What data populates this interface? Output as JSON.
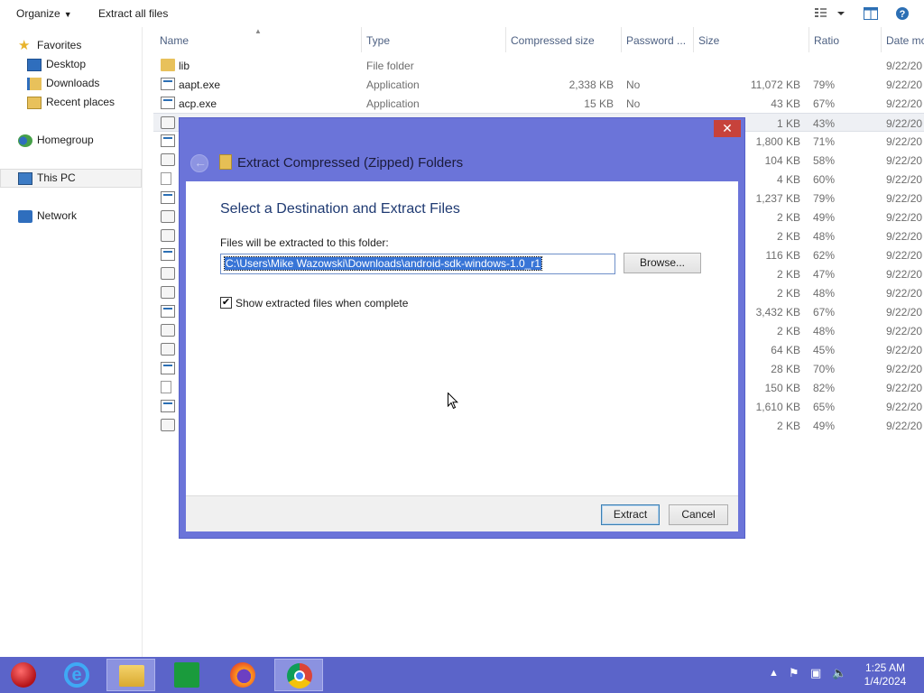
{
  "toolbar": {
    "organize_label": "Organize",
    "extract_all_label": "Extract all files"
  },
  "nav": {
    "favorites": "Favorites",
    "desktop": "Desktop",
    "downloads": "Downloads",
    "recent_places": "Recent places",
    "homegroup": "Homegroup",
    "this_pc": "This PC",
    "network": "Network"
  },
  "columns": {
    "name": "Name",
    "type": "Type",
    "compressed_size": "Compressed size",
    "password": "Password ...",
    "size": "Size",
    "ratio": "Ratio",
    "date": "Date mo"
  },
  "rows": [
    {
      "name": "lib",
      "type": "File folder",
      "compressed": "",
      "password": "",
      "size": "",
      "ratio": "",
      "date": "9/22/20",
      "icon": "folder-icon"
    },
    {
      "name": "aapt.exe",
      "type": "Application",
      "compressed": "2,338 KB",
      "password": "No",
      "size": "11,072 KB",
      "ratio": "79%",
      "date": "9/22/20",
      "icon": "application-icon"
    },
    {
      "name": "acp.exe",
      "type": "Application",
      "compressed": "15 KB",
      "password": "No",
      "size": "43 KB",
      "ratio": "67%",
      "date": "9/22/20",
      "icon": "application-icon"
    },
    {
      "name": "",
      "type": "",
      "compressed": "",
      "password": "",
      "size": "1 KB",
      "ratio": "43%",
      "date": "9/22/20",
      "icon": "settings-file-icon"
    },
    {
      "name": "",
      "type": "",
      "compressed": "",
      "password": "",
      "size": "1,800 KB",
      "ratio": "71%",
      "date": "9/22/20",
      "icon": "application-icon"
    },
    {
      "name": "",
      "type": "",
      "compressed": "",
      "password": "",
      "size": "104 KB",
      "ratio": "58%",
      "date": "9/22/20",
      "icon": "settings-file-icon"
    },
    {
      "name": "",
      "type": "",
      "compressed": "",
      "password": "",
      "size": "4 KB",
      "ratio": "60%",
      "date": "9/22/20",
      "icon": "document-icon"
    },
    {
      "name": "",
      "type": "",
      "compressed": "",
      "password": "",
      "size": "1,237 KB",
      "ratio": "79%",
      "date": "9/22/20",
      "icon": "application-icon"
    },
    {
      "name": "",
      "type": "",
      "compressed": "",
      "password": "",
      "size": "2 KB",
      "ratio": "49%",
      "date": "9/22/20",
      "icon": "settings-file-icon"
    },
    {
      "name": "",
      "type": "",
      "compressed": "",
      "password": "",
      "size": "2 KB",
      "ratio": "48%",
      "date": "9/22/20",
      "icon": "settings-file-icon"
    },
    {
      "name": "",
      "type": "",
      "compressed": "",
      "password": "",
      "size": "116 KB",
      "ratio": "62%",
      "date": "9/22/20",
      "icon": "application-icon"
    },
    {
      "name": "",
      "type": "",
      "compressed": "",
      "password": "",
      "size": "2 KB",
      "ratio": "47%",
      "date": "9/22/20",
      "icon": "settings-file-icon"
    },
    {
      "name": "",
      "type": "",
      "compressed": "",
      "password": "",
      "size": "2 KB",
      "ratio": "48%",
      "date": "9/22/20",
      "icon": "settings-file-icon"
    },
    {
      "name": "",
      "type": "",
      "compressed": "",
      "password": "",
      "size": "3,432 KB",
      "ratio": "67%",
      "date": "9/22/20",
      "icon": "application-icon"
    },
    {
      "name": "",
      "type": "",
      "compressed": "",
      "password": "",
      "size": "2 KB",
      "ratio": "48%",
      "date": "9/22/20",
      "icon": "settings-file-icon"
    },
    {
      "name": "",
      "type": "",
      "compressed": "",
      "password": "",
      "size": "64 KB",
      "ratio": "45%",
      "date": "9/22/20",
      "icon": "settings-file-icon"
    },
    {
      "name": "",
      "type": "",
      "compressed": "",
      "password": "",
      "size": "28 KB",
      "ratio": "70%",
      "date": "9/22/20",
      "icon": "application-icon"
    },
    {
      "name": "",
      "type": "",
      "compressed": "",
      "password": "",
      "size": "150 KB",
      "ratio": "82%",
      "date": "9/22/20",
      "icon": "document-icon"
    },
    {
      "name": "",
      "type": "",
      "compressed": "",
      "password": "",
      "size": "1,610 KB",
      "ratio": "65%",
      "date": "9/22/20",
      "icon": "application-icon"
    },
    {
      "name": "",
      "type": "",
      "compressed": "",
      "password": "",
      "size": "2 KB",
      "ratio": "49%",
      "date": "9/22/20",
      "icon": "settings-file-icon"
    }
  ],
  "dialog": {
    "title": "Extract Compressed (Zipped) Folders",
    "heading": "Select a Destination and Extract Files",
    "dest_label": "Files will be extracted to this folder:",
    "dest_path": "C:\\Users\\Mike Wazowski\\Downloads\\android-sdk-windows-1.0_r1",
    "browse_label": "Browse...",
    "show_files_label": "Show extracted files when complete",
    "show_files_checked": true,
    "extract_label": "Extract",
    "cancel_label": "Cancel",
    "close_glyph": "✕"
  },
  "taskbar": {
    "apps": [
      "start-orb-icon",
      "internet-explorer-icon",
      "file-explorer-icon",
      "store-icon",
      "firefox-icon",
      "chrome-icon"
    ],
    "time": "1:25 AM",
    "date": "1/4/2024"
  },
  "colors": {
    "dialog_frame": "#6b74d9",
    "taskbar": "#5b64c9",
    "close_button": "#c7423b",
    "heading": "#1f3a72",
    "selection": "#3875d7"
  }
}
